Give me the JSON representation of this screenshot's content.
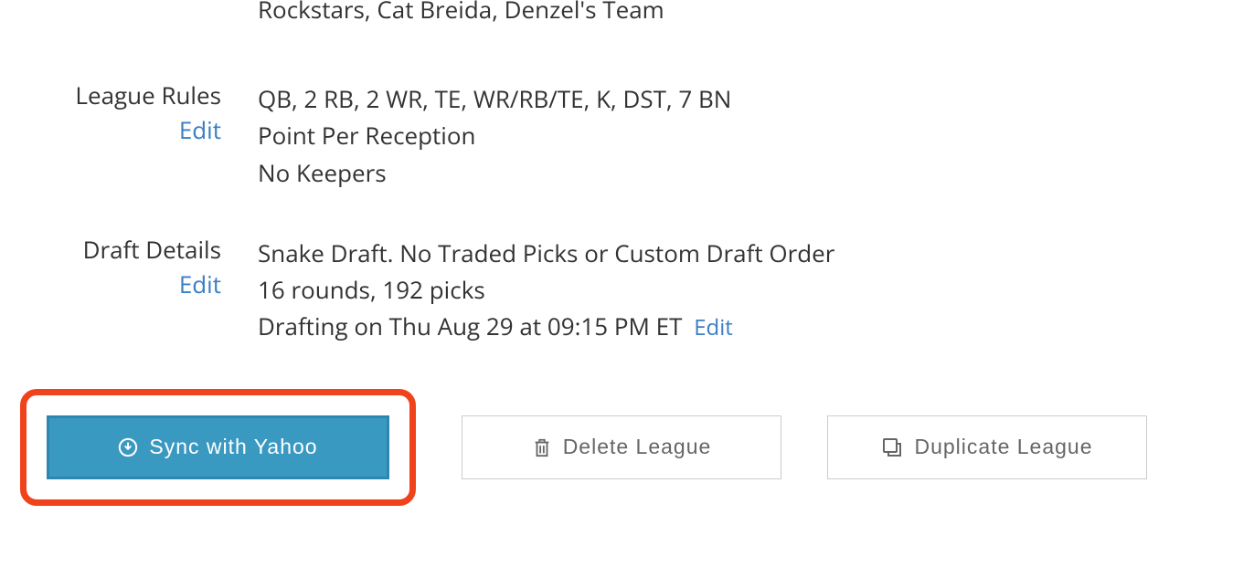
{
  "truncated": {
    "teams": "Rockstars, Cat Breida, Denzel's Team"
  },
  "leagueRules": {
    "label": "League Rules",
    "editLabel": "Edit",
    "roster": "QB, 2 RB, 2 WR, TE, WR/RB/TE, K, DST, 7 BN",
    "scoring": "Point Per Reception",
    "keepers": "No Keepers"
  },
  "draftDetails": {
    "label": "Draft Details",
    "editLabel": "Edit",
    "type": "Snake Draft. No Traded Picks or Custom Draft Order",
    "rounds": "16 rounds, 192 picks",
    "date": "Drafting on Thu Aug 29 at 09:15 PM ET",
    "dateEditLabel": "Edit"
  },
  "buttons": {
    "sync": "Sync with Yahoo",
    "delete": "Delete League",
    "duplicate": "Duplicate League"
  }
}
